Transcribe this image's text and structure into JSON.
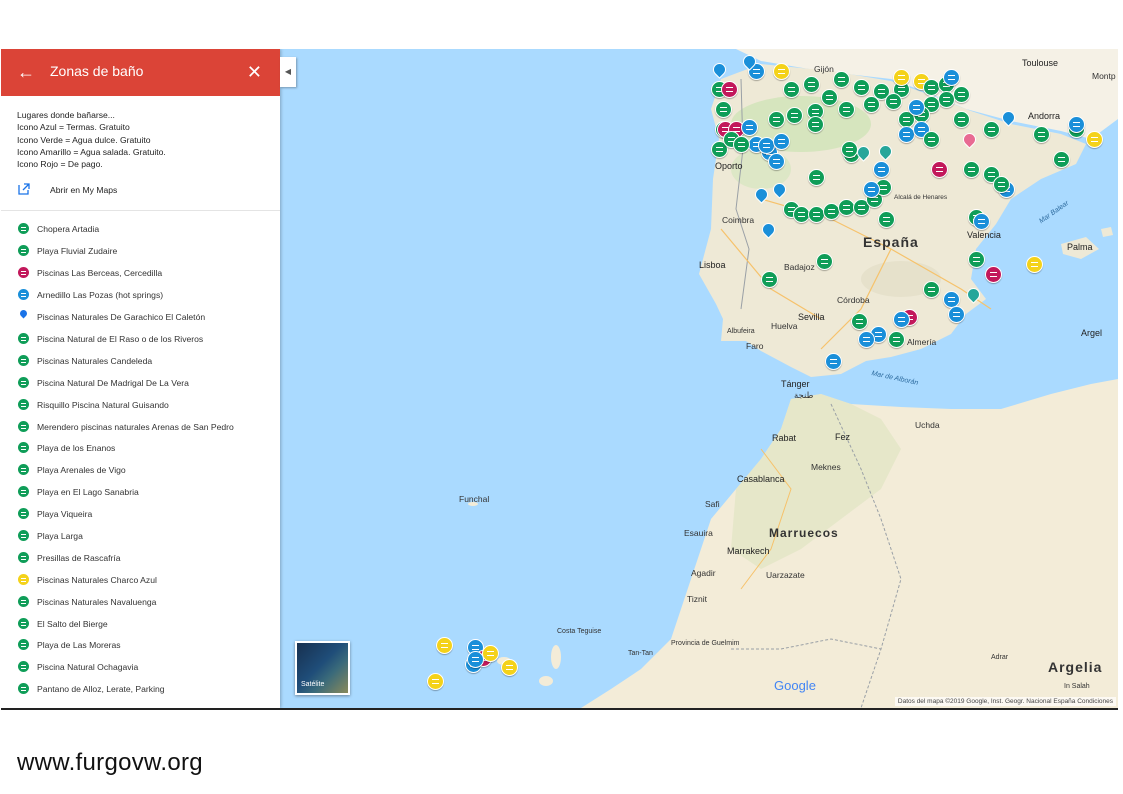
{
  "sidebar": {
    "title": "Zonas de baño",
    "back_icon": "arrow-left-icon",
    "close_icon": "close-icon",
    "description": [
      "Lugares donde bañarse...",
      "Icono Azul = Termas. Gratuito",
      "Icono Verde = Agua dulce. Gratuito",
      "Icono Amarillo = Agua salada. Gratuito.",
      "Icono Rojo = De pago."
    ],
    "open_label": "Abrir en My Maps",
    "items": [
      {
        "label": "Chopera Artadia",
        "color": "green"
      },
      {
        "label": "Playa Fluvial Zudaire",
        "color": "green"
      },
      {
        "label": "Piscinas Las Berceas, Cercedilla",
        "color": "red"
      },
      {
        "label": "Arnedillo Las Pozas (hot springs)",
        "color": "blue"
      },
      {
        "label": "Piscinas Naturales De Garachico El Caletón",
        "color": "pin"
      },
      {
        "label": "Piscina Natural de El Raso o de los Riveros",
        "color": "green"
      },
      {
        "label": "Piscinas Naturales Candeleda",
        "color": "green"
      },
      {
        "label": "Piscina Natural De Madrigal De La Vera",
        "color": "green"
      },
      {
        "label": "Risquillo Piscina Natural Guisando",
        "color": "green"
      },
      {
        "label": "Merendero piscinas naturales Arenas de San Pedro",
        "color": "green"
      },
      {
        "label": "Playa de los Enanos",
        "color": "green"
      },
      {
        "label": "Playa Arenales de Vigo",
        "color": "green"
      },
      {
        "label": "Playa en El Lago Sanabria",
        "color": "green"
      },
      {
        "label": "Playa Viqueira",
        "color": "green"
      },
      {
        "label": "Playa Larga",
        "color": "green"
      },
      {
        "label": "Presillas de Rascafría",
        "color": "green"
      },
      {
        "label": "Piscinas Naturales Charco Azul",
        "color": "yellow"
      },
      {
        "label": "Piscinas Naturales Navaluenga",
        "color": "green"
      },
      {
        "label": "El Salto del Bierge",
        "color": "green"
      },
      {
        "label": "Playa de Las Moreras",
        "color": "green"
      },
      {
        "label": "Piscina Natural Ochagavia",
        "color": "green"
      },
      {
        "label": "Pantano de Alloz, Lerate, Parking",
        "color": "green"
      }
    ]
  },
  "colors": {
    "green": "#0f9d58",
    "blue": "#1a8fd9",
    "yellow": "#f4d21a",
    "red": "#c2185b",
    "pin": "#1a73e8",
    "header": "#db4437"
  },
  "map": {
    "labels": {
      "espana": "España",
      "marruecos": "Marruecos",
      "argelia": "Argelia",
      "lisboa": "Lisboa",
      "oporto": "Oporto",
      "valencia": "Valencia",
      "sevilla": "Sevilla",
      "toulouse": "Toulouse",
      "andorra": "Andorra",
      "palma": "Palma",
      "tanger": "Tánger",
      "rabat": "Rabat",
      "fez": "Fez",
      "casablanca": "Casablanca",
      "marrakech": "Marrakech",
      "funchal": "Funchal",
      "argel": "Argel",
      "gijon": "Gijón",
      "coimbra": "Coimbra",
      "badajoz": "Badajoz",
      "cordoba": "Córdoba",
      "almeria": "Almería",
      "huelva": "Huelva",
      "faro": "Faro",
      "meknes": "Meknes",
      "tanger_ar": "طنجة",
      "safi": "Safi",
      "essaouira": "Esauira",
      "agadir": "Agadir",
      "costa_teguise": "Costa Teguise",
      "mar_alboran": "Mar de Alborán",
      "mar_balear": "Mar Balear",
      "alcala": "Alcalá de Henares",
      "uchda": "Uchda",
      "montp": "Montp",
      "ouarzazate": "Uarzazate",
      "tiznit": "Tiznit",
      "guelmim": "Provincia de Guelmim",
      "adrar": "Adrar",
      "in_salah": "In Salah",
      "tan_tan": "Tan-Tan",
      "albufeira": "Albufeira"
    },
    "satellite_label": "Satélite",
    "google_logo": "Google",
    "attribution": "Datos del mapa ©2019 Google, Inst. Geogr. Nacional   España   Condiciones"
  },
  "watermark": "www.furgovw.org"
}
